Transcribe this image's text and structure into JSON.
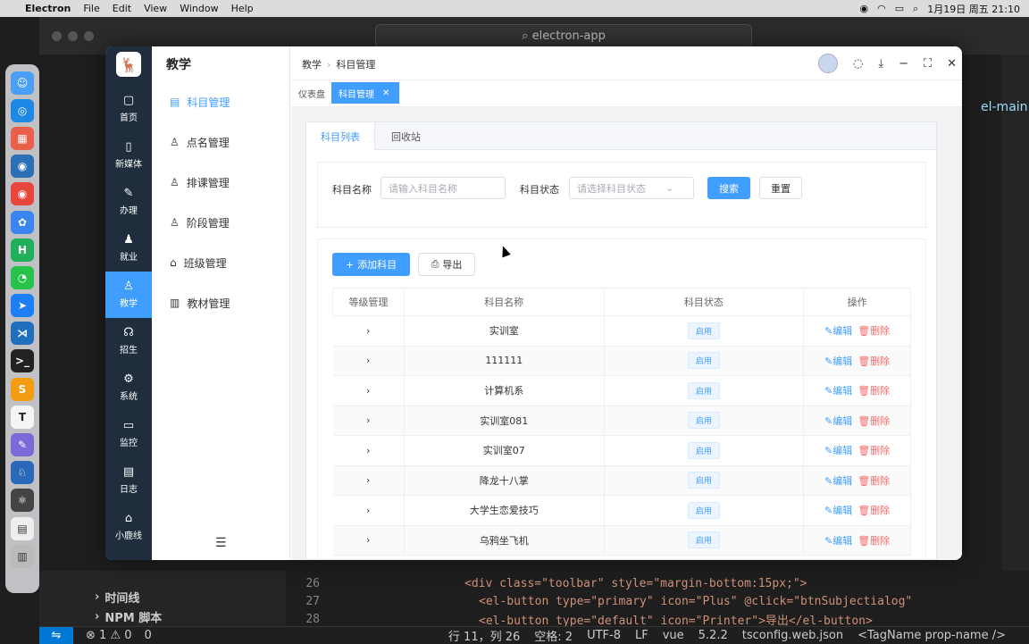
{
  "menubar": {
    "app": "Electron",
    "items": [
      "File",
      "Edit",
      "View",
      "Window",
      "Help"
    ],
    "datetime": "1月19日 周五 21:10"
  },
  "vscode": {
    "search": "electron-app",
    "side_rows": [
      "时间线",
      "NPM 脚本"
    ],
    "code": [
      {
        "ln": "26",
        "text": "<div class=\"toolbar\" style=\"margin-bottom:15px;\">"
      },
      {
        "ln": "27",
        "text": "<el-button type=\"primary\" icon=\"Plus\" @click=\"btnSubjectialog\""
      },
      {
        "ln": "28",
        "text": "<el-button type=\"default\" icon=\"Printer\">导出</el-button>"
      }
    ],
    "right_tab": "el-main",
    "status": {
      "errors": "⊗ 1 ⚠ 0",
      "ports": "0",
      "position": "行 11，列 26",
      "spaces": "空格: 2",
      "encoding": "UTF-8",
      "eol": "LF",
      "lang": "vue",
      "version": "5.2.2",
      "tsconfig": "tsconfig.web.json",
      "tag": "<TagName prop-name />"
    }
  },
  "app": {
    "nav1": [
      {
        "icon": "▢",
        "label": "首页"
      },
      {
        "icon": "▯",
        "label": "新媒体"
      },
      {
        "icon": "✎",
        "label": "办理"
      },
      {
        "icon": "♟",
        "label": "就业"
      },
      {
        "icon": "♙",
        "label": "教学"
      },
      {
        "icon": "☊",
        "label": "招生"
      },
      {
        "icon": "⚙",
        "label": "系统"
      },
      {
        "icon": "▭",
        "label": "监控"
      },
      {
        "icon": "▤",
        "label": "日志"
      },
      {
        "icon": "⌂",
        "label": "小鹿线"
      }
    ],
    "nav2": {
      "title": "教学",
      "items": [
        {
          "icon": "▤",
          "label": "科目管理"
        },
        {
          "icon": "♙",
          "label": "点名管理"
        },
        {
          "icon": "♙",
          "label": "排课管理"
        },
        {
          "icon": "♙",
          "label": "阶段管理"
        },
        {
          "icon": "⌂",
          "label": "班级管理"
        },
        {
          "icon": "▥",
          "label": "教材管理"
        }
      ]
    },
    "breadcrumb": [
      "教学",
      "科目管理"
    ],
    "tags": [
      "仪表盘",
      "科目管理"
    ],
    "tabs": [
      "科目列表",
      "回收站"
    ],
    "search": {
      "name_label": "科目名称",
      "name_placeholder": "请输入科目名称",
      "status_label": "科目状态",
      "status_placeholder": "请选择科目状态",
      "search_btn": "搜索",
      "reset_btn": "重置"
    },
    "toolbar": {
      "add": "添加科目",
      "export": "导出"
    },
    "table": {
      "headers": [
        "等级管理",
        "科目名称",
        "科目状态",
        "操作"
      ],
      "rows": [
        {
          "name": "实训室",
          "status": "启用"
        },
        {
          "name": "111111",
          "status": "启用"
        },
        {
          "name": "计算机系",
          "status": "启用"
        },
        {
          "name": "实训室081",
          "status": "启用"
        },
        {
          "name": "实训室07",
          "status": "启用"
        },
        {
          "name": "降龙十八掌",
          "status": "启用"
        },
        {
          "name": "大学生恋爱技巧",
          "status": "启用"
        },
        {
          "name": "乌鸦坐飞机",
          "status": "启用"
        }
      ],
      "edit": "编辑",
      "delete": "删除"
    }
  }
}
